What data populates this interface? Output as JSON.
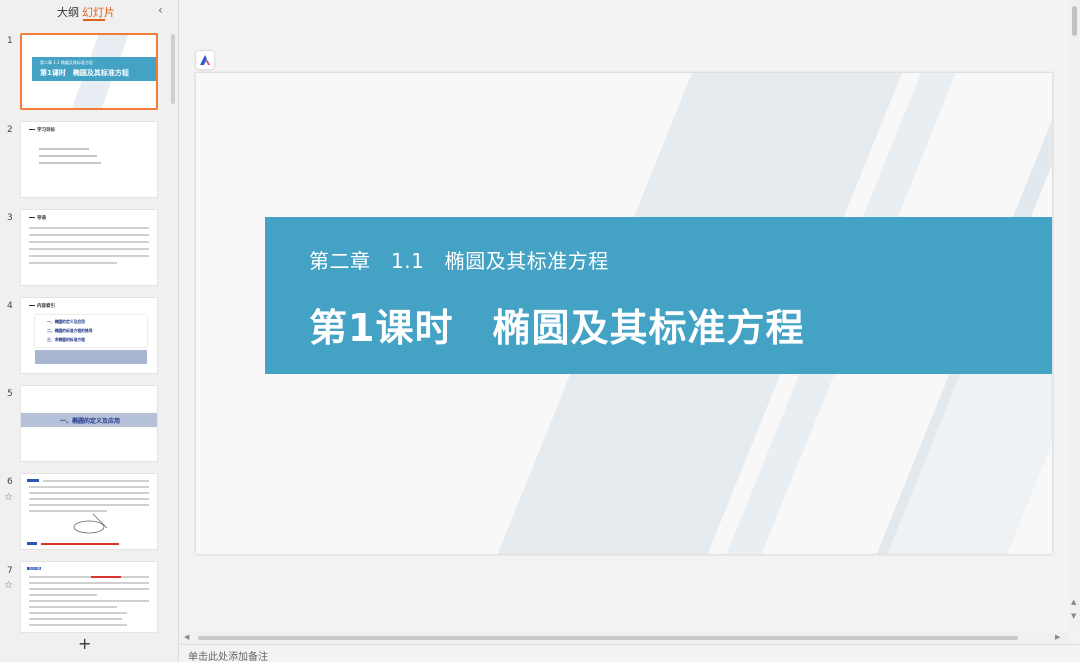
{
  "left_panel": {
    "tabs": [
      {
        "label": "大纲"
      },
      {
        "label": "幻灯片",
        "active": true
      }
    ],
    "thumbnails": [
      {
        "number": "1",
        "selected": true,
        "subtitle": "第二章 1.1 椭圆及其标准方程",
        "title": "第1课时　椭圆及其标准方程"
      },
      {
        "number": "2",
        "header": "学习目标"
      },
      {
        "number": "3",
        "header": "导语"
      },
      {
        "number": "4",
        "header": "内容索引",
        "items": [
          "一、椭圆的定义及应用",
          "二、椭圆的标准方程的推导",
          "三、求椭圆的标准方程"
        ]
      },
      {
        "number": "5",
        "title": "一、椭圆的定义及应用"
      },
      {
        "number": "6",
        "starred": true
      },
      {
        "number": "7",
        "starred": true,
        "header": "知识梳理"
      }
    ],
    "add_slide": "+"
  },
  "slide": {
    "subtitle": "第二章　1.1　椭圆及其标准方程",
    "title": "第1课时　椭圆及其标准方程",
    "band_color": "#44a2c4"
  },
  "notes": {
    "placeholder": "单击此处添加备注"
  },
  "icons": {
    "collapse": "chevron-left-icon",
    "star": "star-outline-icon",
    "logo": "ai-logo-icon"
  }
}
